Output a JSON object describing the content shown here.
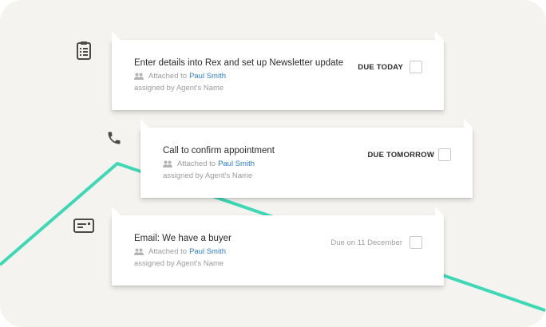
{
  "colors": {
    "background": "#f4f3ef",
    "timeline": "#3ed9b4",
    "link": "#2f7fd3",
    "icon": "#4a4a4a"
  },
  "tasks": [
    {
      "icon": "clipboard-icon",
      "title": "Enter details into Rex and set up Newsletter update",
      "attached_prefix": "Attached to",
      "attached_name": "Paul Smith",
      "assigned": "assigned by Agent's Name",
      "due": "DUE TODAY",
      "checked": false
    },
    {
      "icon": "phone-icon",
      "title": "Call to confirm appointment",
      "attached_prefix": "Attached to",
      "attached_name": "Paul Smith",
      "assigned": "assigned by Agent's Name",
      "due": "DUE TOMORROW",
      "checked": false
    },
    {
      "icon": "email-card-icon",
      "title": "Email: We have a buyer",
      "attached_prefix": "Attached to",
      "attached_name": "Paul Smith",
      "assigned": "assigned by Agent's Name",
      "due": "Due on 11 December",
      "checked": false
    }
  ]
}
